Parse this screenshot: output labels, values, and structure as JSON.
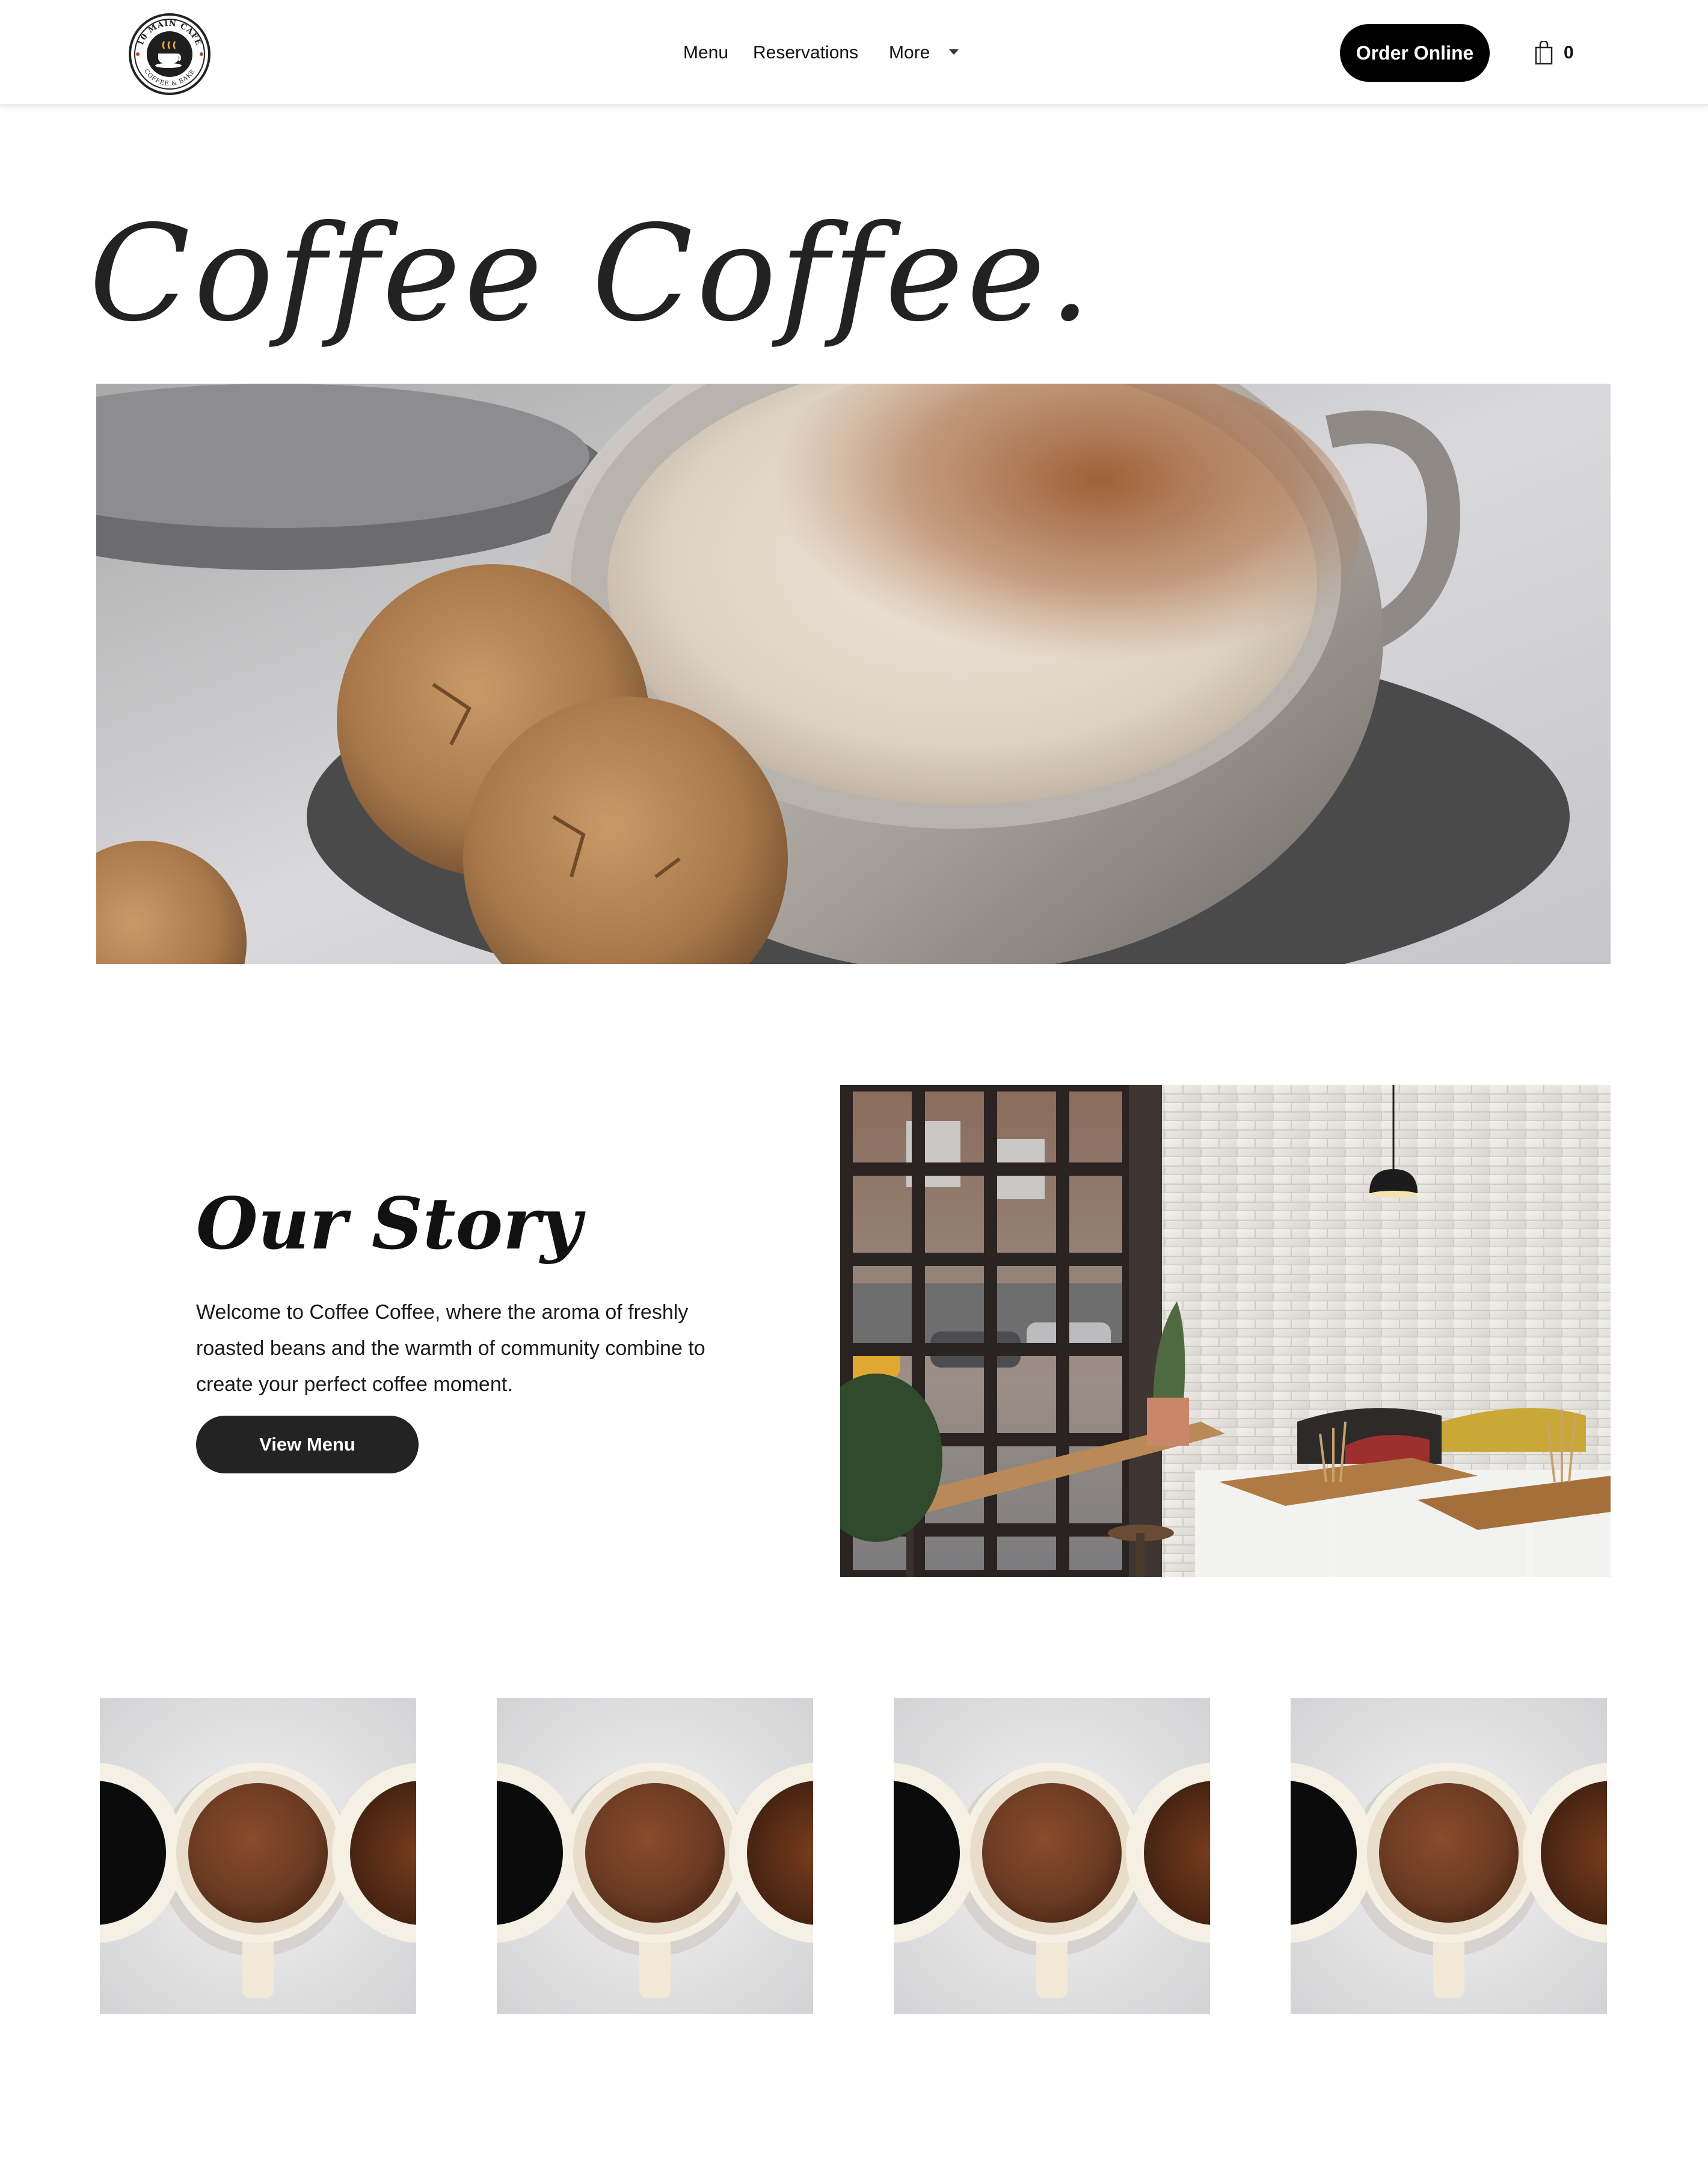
{
  "header": {
    "logo": {
      "ring_text_top": "10 MAIN CAFE",
      "ring_text_bottom": "COFFEE & BAKE"
    },
    "nav": {
      "menu_label": "Menu",
      "reservations_label": "Reservations",
      "more_label": "More"
    },
    "order_button_label": "Order Online",
    "cart_count": "0"
  },
  "hero": {
    "title": "Coffee Coffee."
  },
  "story": {
    "title": "Our Story",
    "text": "Welcome to Coffee Coffee, where the aroma of freshly roasted beans and the warmth of community combine to create your perfect coffee moment.",
    "button_label": "View Menu"
  },
  "icons": {
    "cart": "shopping-bag-icon",
    "caret": "chevron-down-icon"
  },
  "colors": {
    "primary_button": "#000000",
    "secondary_button": "#232323",
    "text": "#111111",
    "background": "#ffffff"
  }
}
